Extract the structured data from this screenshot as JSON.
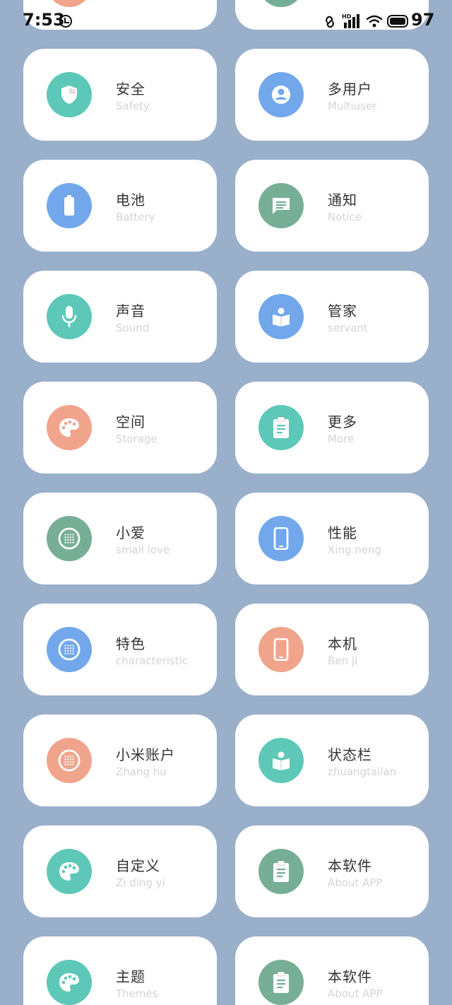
{
  "status_bar": {
    "time": "7:53",
    "battery": "97",
    "network": "HD"
  },
  "colors": {
    "background": "#9aafca",
    "teal": "#5dc8b7",
    "blue": "#72a7ec",
    "green": "#77ae96",
    "salmon": "#f0a48c"
  },
  "tiles": [
    {
      "title": "安全",
      "subtitle": "Safety",
      "icon": "shield-icon",
      "color": "#5dc8b7"
    },
    {
      "title": "多用户",
      "subtitle": "Multiuser",
      "icon": "user-icon",
      "color": "#72a7ec"
    },
    {
      "title": "电池",
      "subtitle": "Battery",
      "icon": "battery-icon",
      "color": "#72a7ec"
    },
    {
      "title": "通知",
      "subtitle": "Notice",
      "icon": "message-icon",
      "color": "#77ae96"
    },
    {
      "title": "声音",
      "subtitle": "Sound",
      "icon": "microphone-icon",
      "color": "#5dc8b7"
    },
    {
      "title": "管家",
      "subtitle": "servant",
      "icon": "book-icon",
      "color": "#72a7ec"
    },
    {
      "title": "空间",
      "subtitle": "Storage",
      "icon": "palette-icon",
      "color": "#f0a48c"
    },
    {
      "title": "更多",
      "subtitle": "More",
      "icon": "clipboard-icon",
      "color": "#5dc8b7"
    },
    {
      "title": "小爱",
      "subtitle": "small love",
      "icon": "dots-grid-icon",
      "color": "#77ae96"
    },
    {
      "title": "性能",
      "subtitle": "Xing neng",
      "icon": "phone-icon",
      "color": "#72a7ec"
    },
    {
      "title": "特色",
      "subtitle": "characteristic",
      "icon": "dots-grid-icon",
      "color": "#72a7ec"
    },
    {
      "title": "本机",
      "subtitle": "Ben ji",
      "icon": "phone-icon",
      "color": "#f0a48c"
    },
    {
      "title": "小米账户",
      "subtitle": "Zhang hu",
      "icon": "dots-grid-icon",
      "color": "#f0a48c"
    },
    {
      "title": "状态栏",
      "subtitle": "zhuangtailan",
      "icon": "book-icon",
      "color": "#5dc8b7"
    },
    {
      "title": "自定义",
      "subtitle": "Zi ding yi",
      "icon": "palette-icon",
      "color": "#5dc8b7"
    },
    {
      "title": "本软件",
      "subtitle": "About APP",
      "icon": "clipboard-icon",
      "color": "#77ae96"
    },
    {
      "title": "主题",
      "subtitle": "Themes",
      "icon": "palette-icon",
      "color": "#5dc8b7"
    },
    {
      "title": "本软件",
      "subtitle": "About APP",
      "icon": "clipboard-icon",
      "color": "#77ae96"
    }
  ]
}
